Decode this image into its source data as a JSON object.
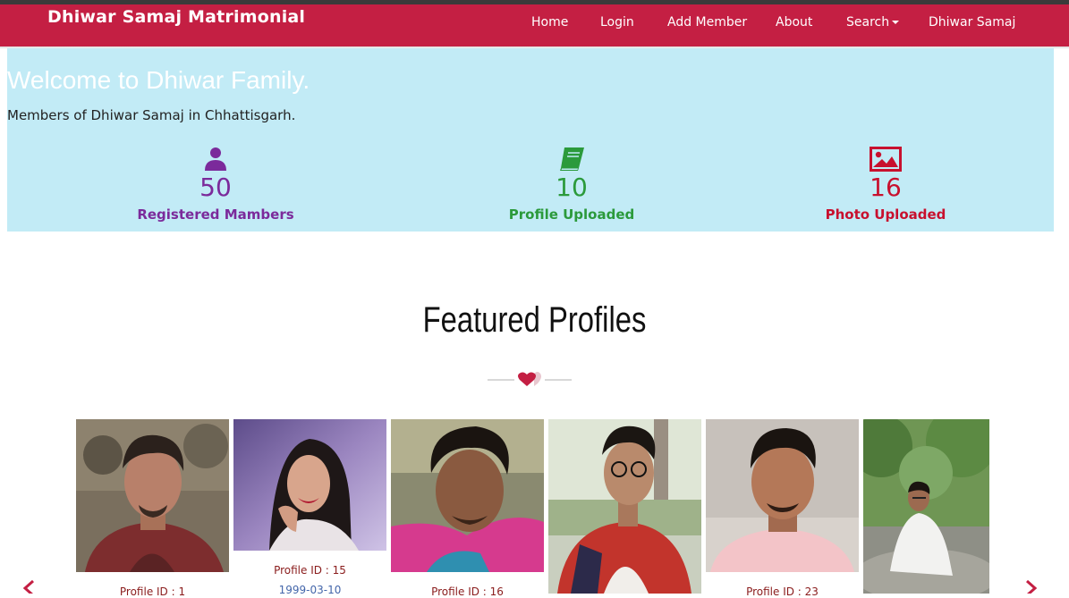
{
  "brand": "Dhiwar Samaj Matrimonial",
  "nav": {
    "home": "Home",
    "login": "Login",
    "add_member": "Add Member",
    "about": "About",
    "search": "Search",
    "samaj": "Dhiwar Samaj"
  },
  "hero": {
    "title": "Welcome to Dhiwar Family.",
    "subtitle": "Members of Dhiwar Samaj in Chhattisgarh."
  },
  "stats": [
    {
      "icon": "user-icon",
      "value": "50",
      "label": "Registered Mambers",
      "color": "#7b2a9b"
    },
    {
      "icon": "book-icon",
      "value": "10",
      "label": "Profile Uploaded",
      "color": "#2b9a3b"
    },
    {
      "icon": "image-icon",
      "value": "16",
      "label": "Photo Uploaded",
      "color": "#c8102e"
    }
  ],
  "featured": {
    "title": "Featured Profiles",
    "profiles": [
      {
        "id_label": "Profile ID : 1",
        "dob": ""
      },
      {
        "id_label": "Profile ID : 15",
        "dob": "1999-03-10"
      },
      {
        "id_label": "Profile ID : 16",
        "dob": ""
      },
      {
        "id_label": "",
        "dob": ""
      },
      {
        "id_label": "Profile ID : 23",
        "dob": ""
      },
      {
        "id_label": "",
        "dob": ""
      }
    ]
  },
  "colors": {
    "navbar": "#c41f43",
    "hero_bg": "#c2ebf6",
    "accent": "#c41f43"
  }
}
